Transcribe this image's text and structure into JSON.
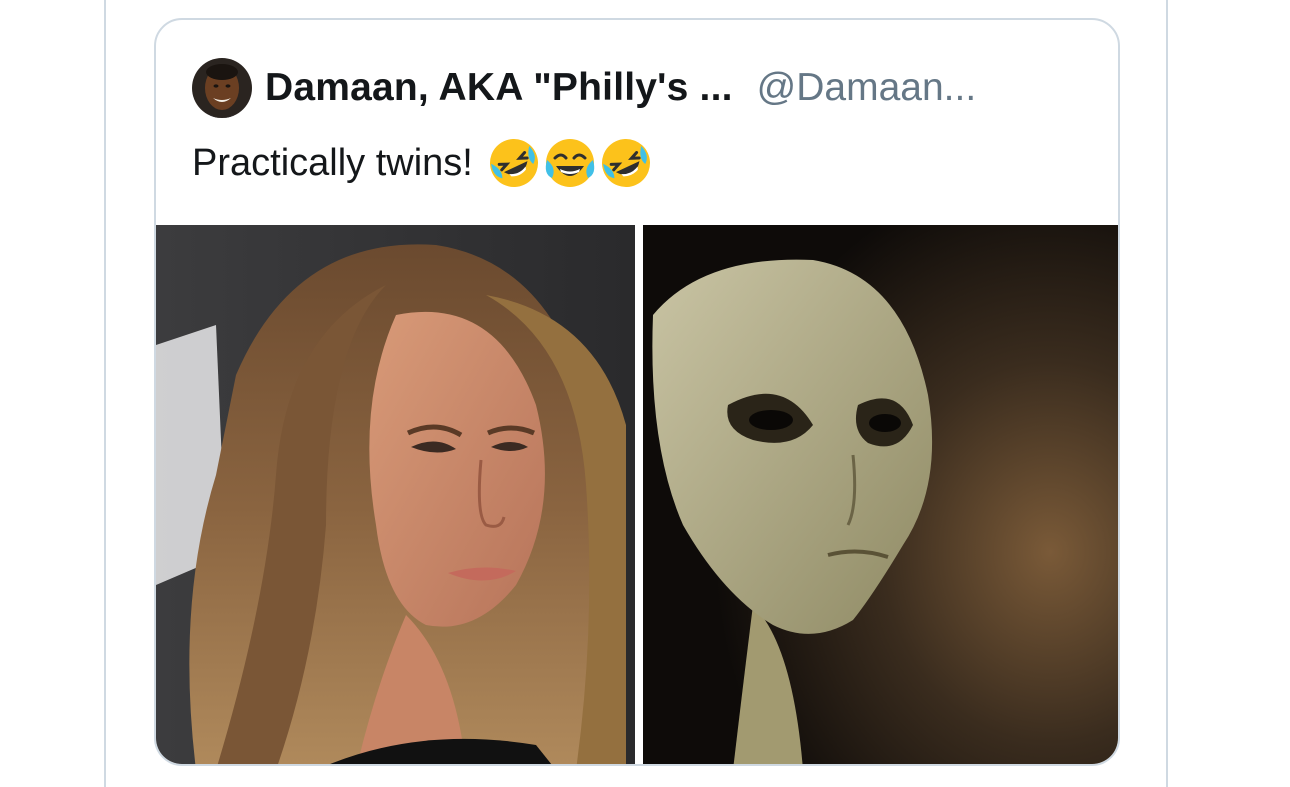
{
  "quoted_tweet": {
    "author_name": "Damaan, AKA \"Philly's ...",
    "author_handle": "@Damaan...",
    "text": "Practically twins!",
    "emojis": [
      "rolling-on-floor-laughing",
      "face-with-tears-of-joy",
      "rolling-on-floor-laughing"
    ]
  },
  "colors": {
    "border": "#cfd9e2",
    "name_text": "#14171a",
    "handle_text": "#657786"
  }
}
